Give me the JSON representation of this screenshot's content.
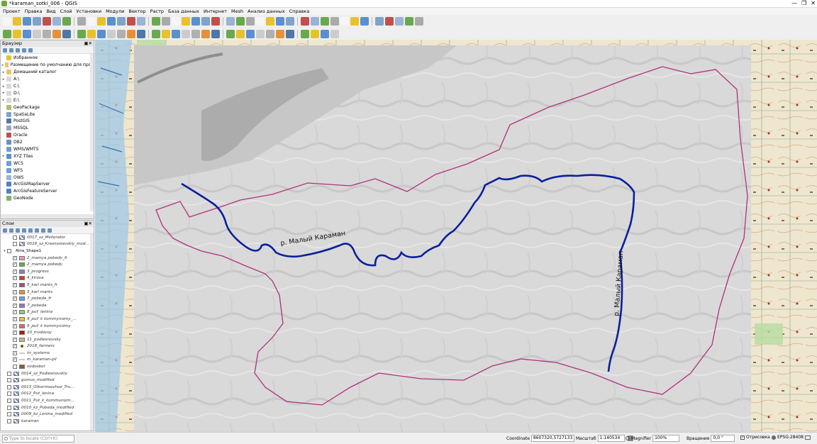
{
  "window": {
    "title": "*karaman_sotki_006 - QGIS",
    "controls": [
      "—",
      "❐",
      "✕"
    ]
  },
  "menu": [
    "Проект",
    "Правка",
    "Вид",
    "Слой",
    "Установки",
    "Модули",
    "Вектор",
    "Растр",
    "База данных",
    "Интернет",
    "Mesh",
    "Анализ данных",
    "Справка"
  ],
  "browser": {
    "title": "Браузер",
    "items": [
      {
        "label": "Избранное",
        "icon": "star-icon",
        "color": "#e8c22d",
        "expand": ""
      },
      {
        "label": "Размещение по умолчанию для прое",
        "icon": "folder-icon",
        "color": "#e6c46a",
        "expand": "▸"
      },
      {
        "label": "Домашний каталог",
        "icon": "folder-icon",
        "color": "#e6c46a",
        "expand": "▸"
      },
      {
        "label": "A:\\",
        "icon": "drive-icon",
        "color": "#d9d9d9",
        "expand": "▸"
      },
      {
        "label": "C:\\",
        "icon": "drive-icon",
        "color": "#d9d9d9",
        "expand": "▸"
      },
      {
        "label": "D:\\",
        "icon": "drive-icon",
        "color": "#d9d9d9",
        "expand": "▸"
      },
      {
        "label": "E:\\",
        "icon": "drive-icon",
        "color": "#d9d9d9",
        "expand": "▸"
      },
      {
        "label": "GeoPackage",
        "icon": "geopackage-icon",
        "color": "#a8c26a",
        "expand": ""
      },
      {
        "label": "SpatiaLite",
        "icon": "spatialite-icon",
        "color": "#7fa3c9",
        "expand": ""
      },
      {
        "label": "PostGIS",
        "icon": "postgis-icon",
        "color": "#4f78a8",
        "expand": ""
      },
      {
        "label": "MSSQL",
        "icon": "mssql-icon",
        "color": "#9aa5b5",
        "expand": ""
      },
      {
        "label": "Oracle",
        "icon": "oracle-icon",
        "color": "#c0504d",
        "expand": ""
      },
      {
        "label": "DB2",
        "icon": "db2-icon",
        "color": "#6b8fc7",
        "expand": ""
      },
      {
        "label": "WMS/WMTS",
        "icon": "wms-icon",
        "color": "#6e9ed6",
        "expand": ""
      },
      {
        "label": "XYZ Tiles",
        "icon": "xyz-tiles-icon",
        "color": "#5a8fd0",
        "expand": "▸"
      },
      {
        "label": "WCS",
        "icon": "wcs-icon",
        "color": "#6e9ed6",
        "expand": ""
      },
      {
        "label": "WFS",
        "icon": "wfs-icon",
        "color": "#6e9ed6",
        "expand": ""
      },
      {
        "label": "OWS",
        "icon": "ows-icon",
        "color": "#9ab3d6",
        "expand": ""
      },
      {
        "label": "ArcGisMapServer",
        "icon": "arcgis-icon",
        "color": "#4d84c4",
        "expand": ""
      },
      {
        "label": "ArcGisFeatureServer",
        "icon": "arcgis-icon",
        "color": "#4d84c4",
        "expand": ""
      },
      {
        "label": "GeoNode",
        "icon": "geonode-icon",
        "color": "#7db36b",
        "expand": ""
      }
    ]
  },
  "layers": {
    "title": "Слои",
    "items": [
      {
        "label": "0017_sz_Meliorator",
        "type": "raster",
        "checked": false,
        "indent": 1,
        "color": "#5b7cc4"
      },
      {
        "label": "0016_sz_Krasnoslavskiy_mod...",
        "type": "raster",
        "checked": false,
        "indent": 1,
        "color": "#5b7cc4"
      },
      {
        "label": "Alna_Shape1",
        "type": "group",
        "checked": false,
        "indent": 0,
        "color": ""
      },
      {
        "label": "2_mamya pobedy_fr",
        "type": "poly",
        "checked": true,
        "indent": 1,
        "color": "#e89bb0"
      },
      {
        "label": "2_mamya pobedy",
        "type": "poly",
        "checked": true,
        "indent": 1,
        "color": "#6aa84f"
      },
      {
        "label": "3_progress",
        "type": "poly",
        "checked": true,
        "indent": 1,
        "color": "#8e7cc3"
      },
      {
        "label": "4_kirova",
        "type": "poly",
        "checked": true,
        "indent": 1,
        "color": "#cc4125"
      },
      {
        "label": "5_karl marks_fr",
        "type": "poly",
        "checked": true,
        "indent": 1,
        "color": "#a64d79"
      },
      {
        "label": "5_karl marks",
        "type": "poly",
        "checked": true,
        "indent": 1,
        "color": "#e69138"
      },
      {
        "label": "7_pobeda_fr",
        "type": "poly",
        "checked": true,
        "indent": 1,
        "color": "#6d9eeb"
      },
      {
        "label": "7_pobeda",
        "type": "poly",
        "checked": true,
        "indent": 1,
        "color": "#8e7cc3"
      },
      {
        "label": "8_put' lenina",
        "type": "poly",
        "checked": true,
        "indent": 1,
        "color": "#93c47d"
      },
      {
        "label": "9_put' k kommynizmy_...",
        "type": "poly",
        "checked": true,
        "indent": 1,
        "color": "#f1c232"
      },
      {
        "label": "9_put' k kommynizmy",
        "type": "poly",
        "checked": true,
        "indent": 1,
        "color": "#e06666"
      },
      {
        "label": "10_trudovoy",
        "type": "poly",
        "checked": true,
        "indent": 1,
        "color": "#cc0000"
      },
      {
        "label": "11_podlesnovsky",
        "type": "poly",
        "checked": true,
        "indent": 1,
        "color": "#c2b59b"
      },
      {
        "label": "2018_farmers",
        "type": "point",
        "checked": true,
        "indent": 1,
        "color": "#7f6000"
      },
      {
        "label": "irr_systems",
        "type": "line",
        "checked": true,
        "indent": 1,
        "color": "#999999"
      },
      {
        "label": "m_karaman-pil",
        "type": "line",
        "checked": true,
        "indent": 1,
        "color": "#999999"
      },
      {
        "label": "vodosbor",
        "type": "poly",
        "checked": false,
        "indent": 1,
        "color": "#a0522d"
      },
      {
        "label": "0014_sz_Podlesnovskiy",
        "type": "raster",
        "checked": false,
        "indent": 0,
        "color": "#5b7cc4"
      },
      {
        "label": "gumus_modified",
        "type": "raster",
        "checked": false,
        "indent": 0,
        "color": "#5b7cc4"
      },
      {
        "label": "0013_Otkormsovhoz_Tru...",
        "type": "raster",
        "checked": false,
        "indent": 0,
        "color": "#5b7cc4"
      },
      {
        "label": "0012_Put_lenina",
        "type": "raster",
        "checked": false,
        "indent": 0,
        "color": "#5b7cc4"
      },
      {
        "label": "0011_Put_k_kommunizm...",
        "type": "raster",
        "checked": false,
        "indent": 0,
        "color": "#5b7cc4"
      },
      {
        "label": "0010_kz_Pobeda_modified",
        "type": "raster",
        "checked": false,
        "indent": 0,
        "color": "#5b7cc4"
      },
      {
        "label": "0009_kz_Lenina_modified",
        "type": "raster",
        "checked": false,
        "indent": 0,
        "color": "#5b7cc4"
      },
      {
        "label": "karaman",
        "type": "raster",
        "checked": false,
        "indent": 0,
        "color": "#5b7cc4"
      }
    ]
  },
  "map": {
    "river_label_1": "р. Малый Караман",
    "river_label_2": "р. Малый Караман",
    "river_color": "#0a1f9c",
    "boundary_color": "#b0307a"
  },
  "status": {
    "locate_placeholder": "Type to locate (Ctrl+K)",
    "coordinate_label": "Coordinate",
    "coordinate_value": "8607320,5727133",
    "scale_label": "Масштаб",
    "scale_value": "1:140534",
    "magnifier_label": "Magnifier",
    "magnifier_value": "100%",
    "rotation_label": "Вращение",
    "rotation_value": "0,0 °",
    "render_label": "Отрисовка",
    "crs_label": "EPSG:28408"
  }
}
